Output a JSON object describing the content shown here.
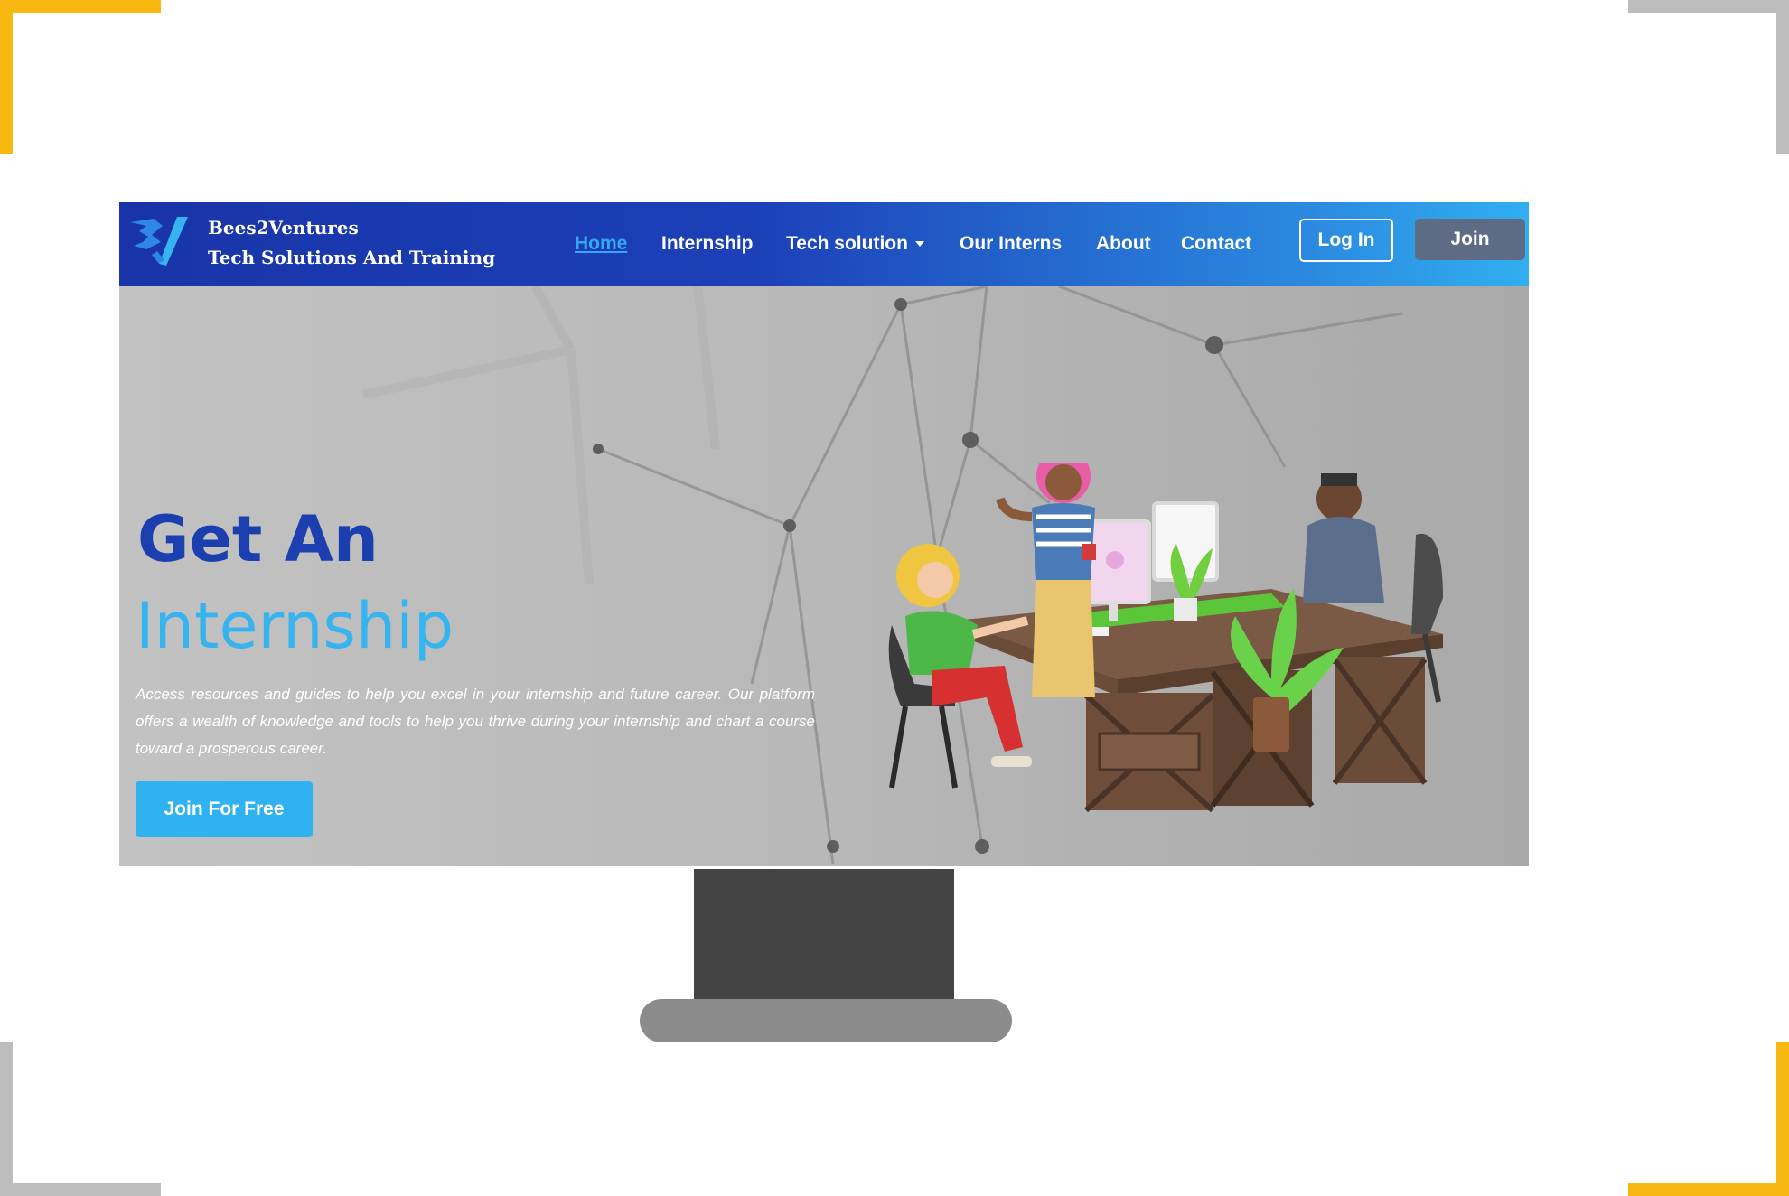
{
  "brand": {
    "name": "Bees2Ventures",
    "tagline": "Tech Solutions And Training",
    "logo_icon": "b2v-logo-icon"
  },
  "nav": {
    "items": [
      {
        "label": "Home",
        "active": true
      },
      {
        "label": "Internship"
      },
      {
        "label": "Tech solution",
        "has_dropdown": true
      },
      {
        "label": "Our Interns"
      },
      {
        "label": "About"
      },
      {
        "label": "Contact"
      }
    ],
    "login_label": "Log In",
    "join_label": "Join"
  },
  "hero": {
    "title_line1": "Get An",
    "title_line2": "Internship",
    "description": "Access resources and guides to help you excel in your internship and future career. Our platform offers a wealth of knowledge and tools to help you thrive during your internship and chart a course toward a prosperous career.",
    "cta_label": "Join For Free",
    "illustration": "team-office-illustration"
  },
  "colors": {
    "navbar_start": "#1934a8",
    "navbar_end": "#31aef0",
    "title_dark_blue": "#1c3fb0",
    "title_light_blue": "#36b4f0",
    "cta_blue": "#31b2f0",
    "join_button": "#5d6c84",
    "corner_accent": "#f8b811",
    "corner_gray": "#bdbdbd",
    "monitor_stand": "#444444",
    "monitor_base": "#8b8b8b"
  }
}
